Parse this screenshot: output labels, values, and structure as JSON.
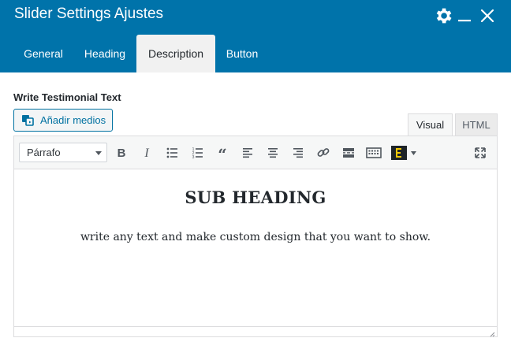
{
  "window": {
    "title": "Slider Settings Ajustes"
  },
  "tabs": [
    {
      "label": "General",
      "active": false
    },
    {
      "label": "Heading",
      "active": false
    },
    {
      "label": "Description",
      "active": true
    },
    {
      "label": "Button",
      "active": false
    }
  ],
  "field": {
    "label": "Write Testimonial Text"
  },
  "media_button": {
    "label": "Añadir medios",
    "icon": "media-icon"
  },
  "editor_modes": {
    "visual": "Visual",
    "html": "HTML",
    "active": "Visual"
  },
  "toolbar": {
    "format_value": "Párrafo",
    "buttons": [
      "bold-icon",
      "italic-icon",
      "bullet-list-icon",
      "numbered-list-icon",
      "blockquote-icon",
      "align-left-icon",
      "align-center-icon",
      "align-right-icon",
      "link-icon",
      "read-more-icon",
      "toolbar-toggle-icon",
      "text-color-icon",
      "fullscreen-icon"
    ]
  },
  "content": {
    "heading": "SUB HEADING",
    "body": "write any text and make custom design that you want to show."
  },
  "colors": {
    "header": "#0073aa",
    "accent": "#0071a1",
    "text_color_swatch": "#f0c808"
  }
}
